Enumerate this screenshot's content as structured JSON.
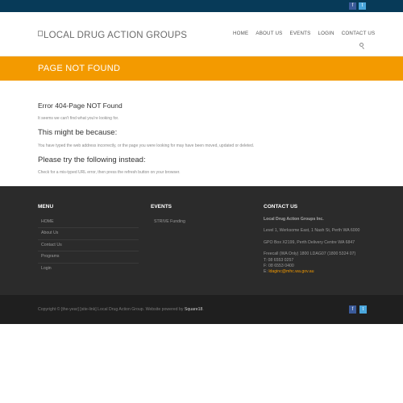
{
  "header": {
    "logo_alt": "LOCAL DRUG ACTION GROUPS",
    "nav": [
      "HOME",
      "ABOUT US",
      "EVENTS",
      "LOGIN",
      "CONTACT US"
    ]
  },
  "banner": {
    "title": "PAGE NOT FOUND"
  },
  "content": {
    "error_heading": "Error 404-Page NOT Found",
    "error_text": "It seems we can't find what you're looking for.",
    "because_heading": "This might be because:",
    "because_text": "You have typed the web address incorrectly, or the page you were looking for may have been moved, updated or deleted.",
    "try_heading": "Please try the following instead:",
    "try_text": "Check for a mis-typed URL error, then press the refresh button on your browser."
  },
  "footer": {
    "menu": {
      "title": "MENU",
      "items": [
        "HOME",
        "About Us",
        "Contact Us",
        "Programs",
        "Login"
      ]
    },
    "events": {
      "title": "EVENTS",
      "items": [
        "STRIVE Funding"
      ]
    },
    "contact": {
      "title": "CONTACT US",
      "org": "Local Drug Action Groups Inc.",
      "address": "Level 1, Werksome East, 1 Nash St, Perth WA 6000",
      "po_box": "GPO Box X2199, Perth Delivery Centre WA 6847",
      "freecall": "Freecall (WA Only) 1800 LDAG07 (1800 5324 07)",
      "phone": "T: 08 6553 0257",
      "fax": "F: 08 6553 0400",
      "email_label": "E: ",
      "email": "ldaginc@mhc.wa.gov.au"
    }
  },
  "bottom": {
    "copyright": "Copyright © [the-year] [site-link] Local Drug Action Group. Website powered by ",
    "powered_by": "Square18",
    "period": "."
  },
  "icons": {
    "facebook": "facebook-icon",
    "twitter": "twitter-icon",
    "search": "search-icon"
  },
  "colors": {
    "topbar": "#073a58",
    "banner": "#f39a00",
    "footer": "#2b2b2b",
    "bottombar": "#1f1f1f",
    "facebook": "#3b5b9a",
    "twitter": "#4aa6dc"
  }
}
